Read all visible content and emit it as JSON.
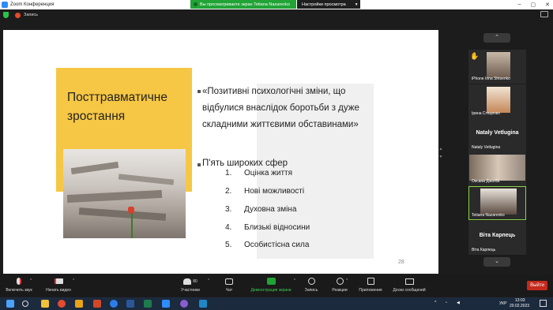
{
  "window": {
    "title": "Zoom Конференция",
    "view_banner": "Вы просматриваете экран Tetiana Nazarenko",
    "view_settings": "Настройки просмотра",
    "view_settings_caret": "▾",
    "recording_label": "Запись"
  },
  "slide": {
    "title": "Посттравматичне зростання",
    "quote": "«Позитивні психологічні зміни, що відбулися внаслідок боротьби з дуже складними життєвими обставинами»",
    "spheres_heading": "П'ять широких сфер",
    "spheres": [
      {
        "num": "1.",
        "label": "Оцінка життя"
      },
      {
        "num": "2.",
        "label": "Нові можливості"
      },
      {
        "num": "3.",
        "label": "Духовна зміна"
      },
      {
        "num": "4.",
        "label": "Близькі відносини"
      },
      {
        "num": "5.",
        "label": "Особистісна сила"
      }
    ],
    "page_number": "28"
  },
  "participants": [
    {
      "name": "iPhone Irina Shtsenko",
      "big": "",
      "has_video": true,
      "hand_raised": true
    },
    {
      "name": "Ірина Стеценко",
      "big": "",
      "has_video": true,
      "hand_raised": false
    },
    {
      "name": "Nataly Vetlugina",
      "big": "Nataly Vetlugina",
      "has_video": false,
      "hand_raised": false
    },
    {
      "name": "Оксана Дзьоба",
      "big": "",
      "has_video": true,
      "hand_raised": false
    },
    {
      "name": "Tetiana Nazarenko",
      "big": "",
      "has_video": true,
      "hand_raised": false,
      "active": true
    },
    {
      "name": "Віта Карпець",
      "big": "Віта Карпець",
      "has_video": false,
      "hand_raised": false
    }
  ],
  "toolbar": {
    "unmute": "Включить звук",
    "start_video": "Начать видео",
    "participants": "Участники",
    "participants_count": "80",
    "chat": "Чат",
    "share_screen": "Демонстрация экрана",
    "record": "Запись",
    "reactions": "Реакции",
    "apps": "Приложения",
    "whiteboards": "Доски сообщений",
    "end": "Выйти"
  },
  "taskbar": {
    "lang": "УКР",
    "time": "13:03",
    "date": "20.02.2023"
  },
  "colors": {
    "accent_yellow": "#f6c744",
    "share_green": "#21a336",
    "end_red": "#c4291b",
    "active_border": "#8ad344"
  }
}
